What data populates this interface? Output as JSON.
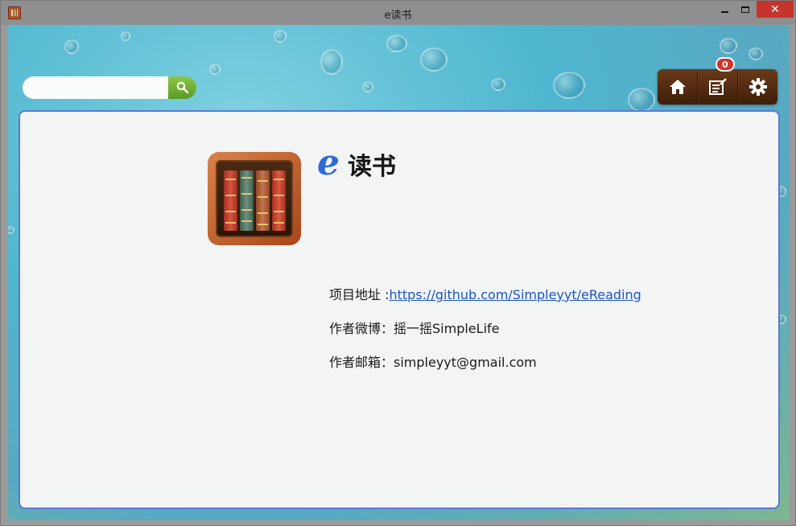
{
  "window": {
    "title": "e读书",
    "minimize_icon": "minimize-icon",
    "maximize_icon": "maximize-icon",
    "close_icon": "close-icon"
  },
  "search": {
    "value": "",
    "placeholder": "",
    "button_icon": "search-icon"
  },
  "toolbar": {
    "items": [
      {
        "icon": "home-icon"
      },
      {
        "icon": "notes-icon",
        "badge": "0"
      },
      {
        "icon": "gear-icon"
      }
    ]
  },
  "about": {
    "app_name_prefix": "e",
    "app_name_rest": "读书",
    "logo_icon": "bookshelf-icon",
    "project_label": "项目地址 :",
    "project_url": "https://github.com/Simpleyyt/eReading",
    "weibo_label": "作者微博：",
    "weibo_value": "摇一摇SimpleLife",
    "email_label": "作者邮箱：",
    "email_value": "simpleyyt@gmail.com"
  },
  "colors": {
    "accent": "#2f6bd6",
    "close": "#c7342c",
    "search_button": "#6faa2e",
    "toolbar": "#5a2f12",
    "badge": "#d2342a",
    "panel_border": "#5b79d6"
  }
}
